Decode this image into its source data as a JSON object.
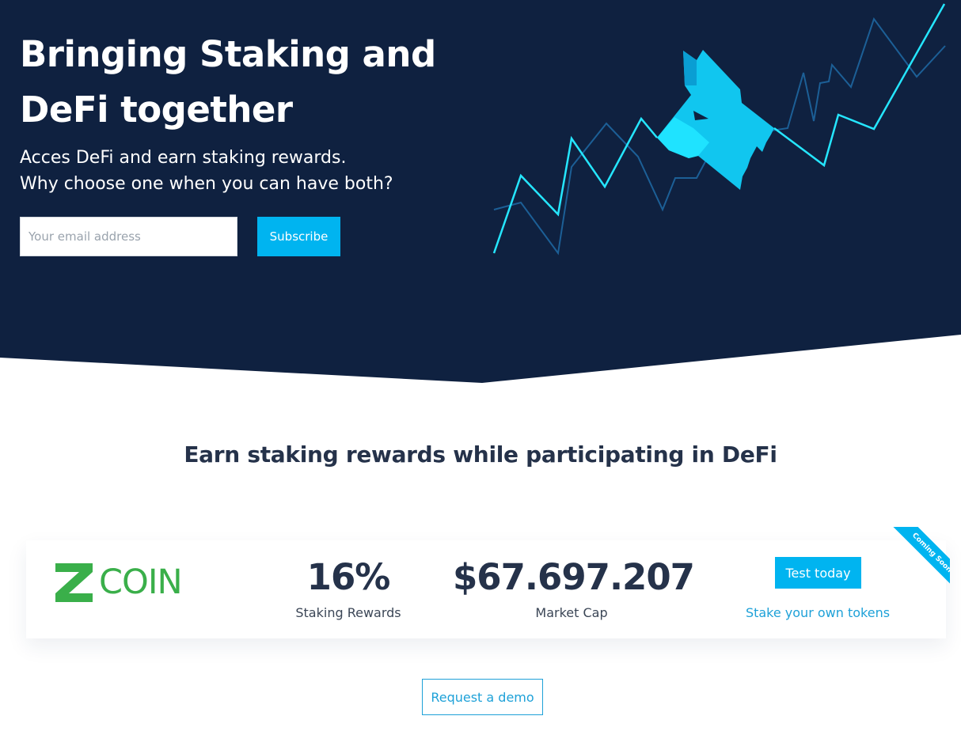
{
  "hero": {
    "title_line1": "Bringing Staking and",
    "title_line2": "DeFi together",
    "subtitle_line1": "Acces DeFi and earn staking rewards.",
    "subtitle_line2": "Why choose one when you can have both?",
    "email_placeholder": "Your email address",
    "subscribe_label": "Subscribe",
    "art_icon": "wolf-chart-illustration"
  },
  "section": {
    "title": "Earn staking rewards while participating in DeFi"
  },
  "card": {
    "logo_text": "COIN",
    "logo_icon": "zcoin-z-logo",
    "staking_value": "16%",
    "staking_label": "Staking Rewards",
    "market_value": "$67.697.207",
    "market_label": "Market Cap",
    "test_label": "Test today",
    "stake_link": "Stake your own tokens",
    "ribbon_label": "Coming Soon"
  },
  "footer": {
    "demo_label": "Request a demo"
  },
  "colors": {
    "navy": "#0f2140",
    "accent": "#00b4f0",
    "cyan_line": "#25e6ff",
    "dark_line": "#1c5f96",
    "zcoin_green": "#3aaf4a",
    "text_dark": "#25324a"
  }
}
